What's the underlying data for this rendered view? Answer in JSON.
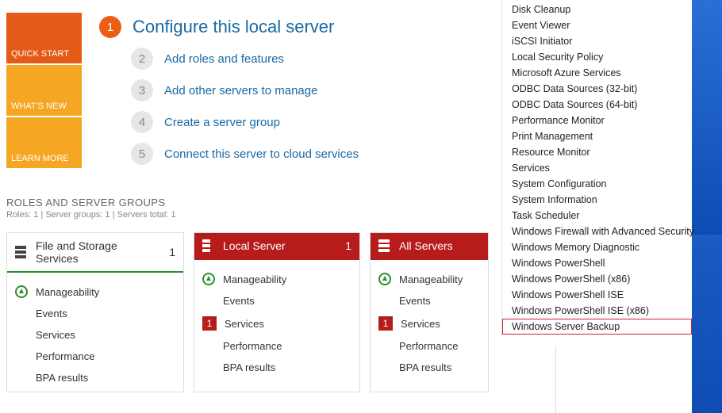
{
  "side_tiles": {
    "quick_start": "QUICK START",
    "whats_new": "WHAT'S NEW",
    "learn_more": "LEARN MORE"
  },
  "steps": [
    {
      "num": "1",
      "label": "Configure this local server",
      "primary": true
    },
    {
      "num": "2",
      "label": "Add roles and features",
      "primary": false
    },
    {
      "num": "3",
      "label": "Add other servers to manage",
      "primary": false
    },
    {
      "num": "4",
      "label": "Create a server group",
      "primary": false
    },
    {
      "num": "5",
      "label": "Connect this server to cloud services",
      "primary": false
    }
  ],
  "section": {
    "title": "ROLES AND SERVER GROUPS",
    "subtitle": "Roles: 1  |  Server groups: 1  |  Servers total: 1"
  },
  "groups": [
    {
      "title": "File and Storage Services",
      "count": "1",
      "style": "white",
      "items": [
        {
          "kind": "ok",
          "label": "Manageability"
        },
        {
          "kind": "plain",
          "label": "Events"
        },
        {
          "kind": "plain",
          "label": "Services"
        },
        {
          "kind": "plain",
          "label": "Performance"
        },
        {
          "kind": "plain",
          "label": "BPA results"
        }
      ]
    },
    {
      "title": "Local Server",
      "count": "1",
      "style": "red",
      "items": [
        {
          "kind": "ok",
          "label": "Manageability"
        },
        {
          "kind": "plain",
          "label": "Events"
        },
        {
          "kind": "badge",
          "badge": "1",
          "label": "Services"
        },
        {
          "kind": "plain",
          "label": "Performance"
        },
        {
          "kind": "plain",
          "label": "BPA results"
        }
      ]
    },
    {
      "title": "All Servers",
      "count": "1",
      "style": "red",
      "items": [
        {
          "kind": "ok",
          "label": "Manageability"
        },
        {
          "kind": "plain",
          "label": "Events"
        },
        {
          "kind": "badge",
          "badge": "1",
          "label": "Services"
        },
        {
          "kind": "plain",
          "label": "Performance"
        },
        {
          "kind": "plain",
          "label": "BPA results"
        }
      ]
    }
  ],
  "tools_menu": [
    "Disk Cleanup",
    "Event Viewer",
    "iSCSI Initiator",
    "Local Security Policy",
    "Microsoft Azure Services",
    "ODBC Data Sources (32-bit)",
    "ODBC Data Sources (64-bit)",
    "Performance Monitor",
    "Print Management",
    "Resource Monitor",
    "Services",
    "System Configuration",
    "System Information",
    "Task Scheduler",
    "Windows Firewall with Advanced Security",
    "Windows Memory Diagnostic",
    "Windows PowerShell",
    "Windows PowerShell (x86)",
    "Windows PowerShell ISE",
    "Windows PowerShell ISE (x86)",
    "Windows Server Backup"
  ],
  "tools_highlight": "Windows Server Backup"
}
